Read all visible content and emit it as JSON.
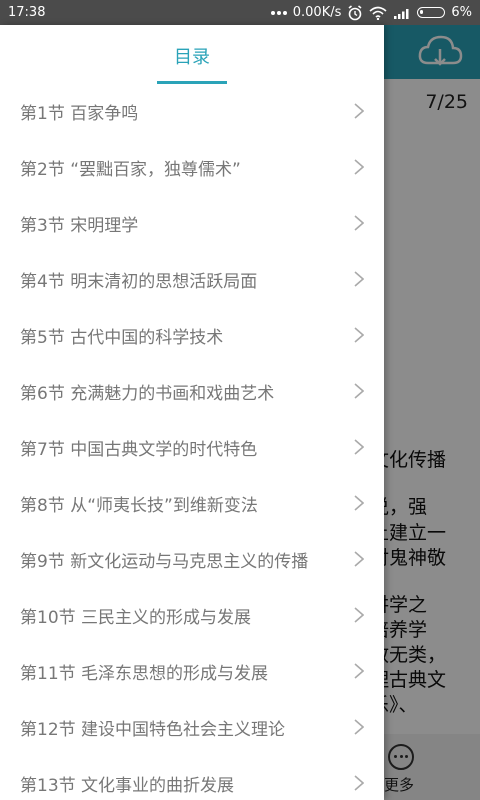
{
  "status_bar": {
    "time": "17:38",
    "network_speed": "0.00K/s",
    "battery_percent": "6%",
    "icons": [
      "signal-dots-icon",
      "alarm-icon",
      "wifi-icon",
      "cell-signal-icon",
      "battery-icon"
    ]
  },
  "reader": {
    "page_indicator": "7/25",
    "text_fragments": [
      "文化传播",
      "说，强",
      "上建立一",
      "对鬼神敬",
      "讲学之",
      "培养学",
      "教无类，",
      "理古典文",
      "乐》、"
    ],
    "bottom_more_label": "更多",
    "colors": {
      "topbar": "#2aa3b8"
    }
  },
  "drawer": {
    "title": "目录",
    "accent_color": "#2aa3b8",
    "items": [
      {
        "label": "第1节  百家争鸣"
      },
      {
        "label": "第2节  “罢黜百家，独尊儒术”"
      },
      {
        "label": "第3节  宋明理学"
      },
      {
        "label": "第4节  明末清初的思想活跃局面"
      },
      {
        "label": "第5节  古代中国的科学技术"
      },
      {
        "label": "第6节  充满魅力的书画和戏曲艺术"
      },
      {
        "label": "第7节  中国古典文学的时代特色"
      },
      {
        "label": "第8节  从“师夷长技”到维新变法"
      },
      {
        "label": "第9节  新文化运动与马克思主义的传播"
      },
      {
        "label": "第10节  三民主义的形成与发展"
      },
      {
        "label": "第11节  毛泽东思想的形成与发展"
      },
      {
        "label": "第12节  建设中国特色社会主义理论"
      },
      {
        "label": "第13节  文化事业的曲折发展"
      }
    ]
  }
}
